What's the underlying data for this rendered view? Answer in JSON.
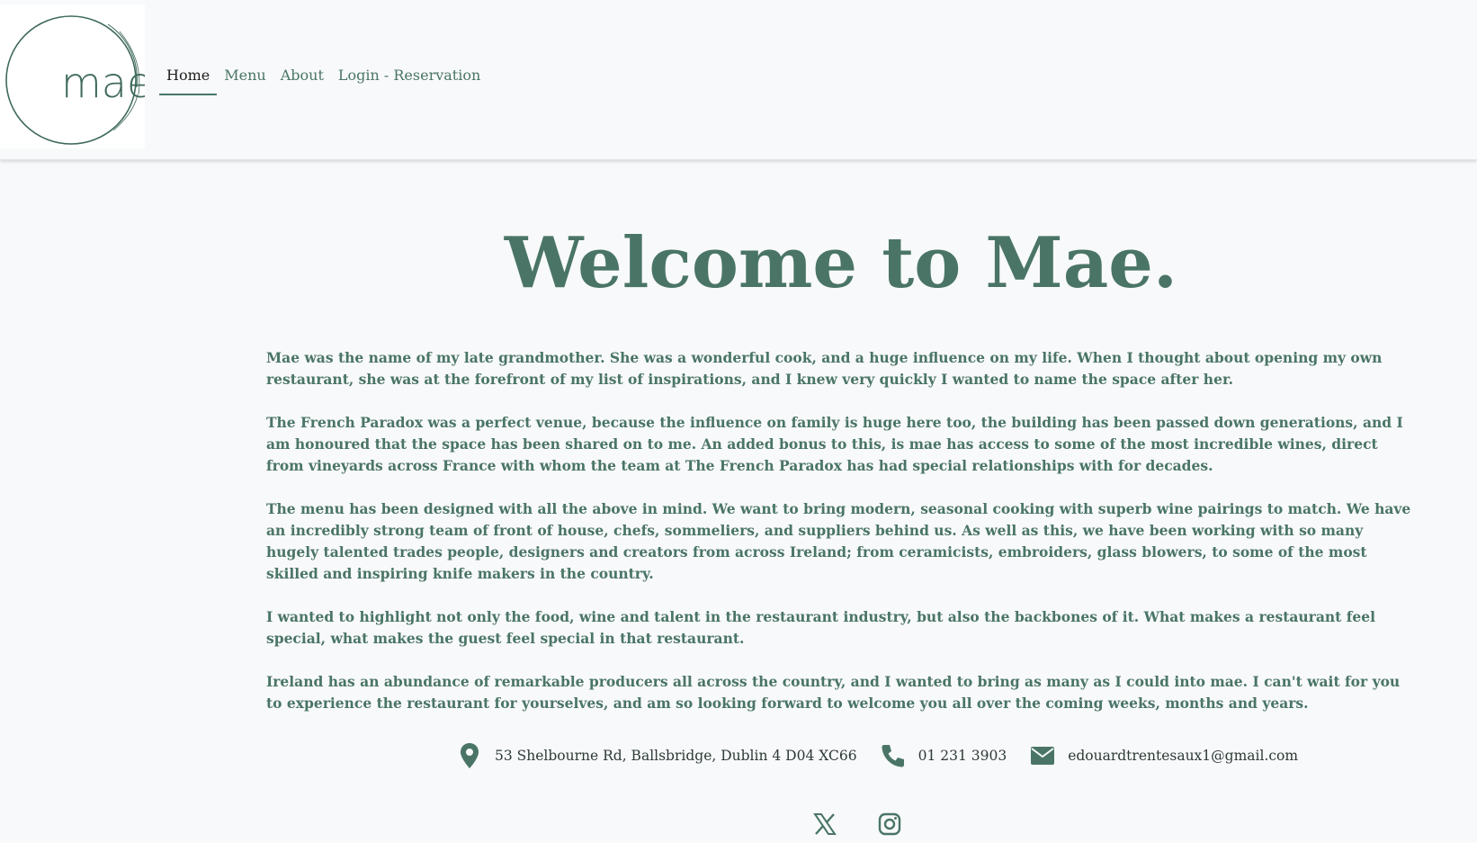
{
  "brand": {
    "logo_text": "mae",
    "accent_color": "#4a7566"
  },
  "nav": {
    "items": [
      {
        "label": "Home",
        "active": true
      },
      {
        "label": "Menu",
        "active": false
      },
      {
        "label": "About",
        "active": false
      },
      {
        "label": "Login - Reservation",
        "active": false
      }
    ]
  },
  "main": {
    "title": "Welcome to Mae.",
    "paragraphs": [
      "Mae was the name of my late grandmother. She was a wonderful cook, and a huge influence on my life. When I thought about opening my own restaurant, she was at the forefront of my list of inspirations, and I knew very quickly I wanted to name the space after her.",
      "The French Paradox was a perfect venue, because the influence on family is huge here too, the building has been passed down generations, and I am honoured that the space has been shared on to me. An added bonus to this, is mae has access to some of the most incredible wines, direct from vineyards across France with whom the team at The French Paradox has had special relationships with for decades.",
      "The menu has been designed with all the above in mind. We want to bring modern, seasonal cooking with superb wine pairings to match. We have an incredibly strong team of front of house, chefs, sommeliers, and suppliers behind us. As well as this, we have been working with so many hugely talented trades people, designers and creators from across Ireland; from ceramicists, embroiders, glass blowers, to some of the most skilled and inspiring knife makers in the country.",
      "I wanted to highlight not only the food, wine and talent in the restaurant industry, but also the backbones of it. What makes a restaurant feel special, what makes the guest feel special in that restaurant.",
      "Ireland has an abundance of remarkable producers all across the country, and I wanted to bring as many as I could into mae. I can't wait for you to experience the restaurant for yourselves, and am so looking forward to welcome you all over the coming weeks, months and years."
    ]
  },
  "contact": {
    "address": {
      "icon": "map-marker-icon",
      "text": "53 Shelbourne Rd, Ballsbridge, Dublin 4 D04 XC66"
    },
    "phone": {
      "icon": "phone-icon",
      "text": "01 231 3903"
    },
    "email": {
      "icon": "envelope-icon",
      "text": "edouardtrentesaux1@gmail.com"
    }
  },
  "social": [
    {
      "icon": "x-twitter-icon"
    },
    {
      "icon": "instagram-icon"
    }
  ]
}
